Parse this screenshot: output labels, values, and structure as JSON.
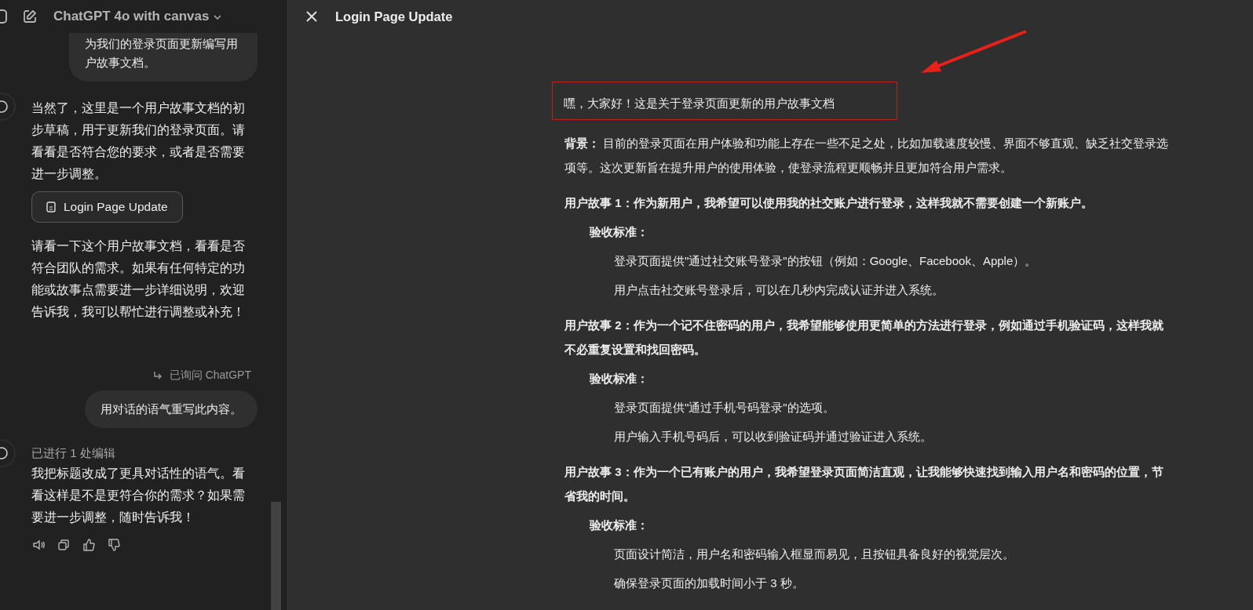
{
  "chat_header": {
    "title": "ChatGPT 4o with canvas"
  },
  "messages": [
    {
      "kind": "user",
      "text": "为我们的登录页面更新编写用户故事文档。"
    },
    {
      "kind": "assistant",
      "paragraphs": [
        "当然了，这里是一个用户故事文档的初步草稿，用于更新我们的登录页面。请看看是否符合您的要求，或者是否需要进一步调整。"
      ],
      "document_button": "Login Page Update",
      "after": "请看一下这个用户故事文档，看看是否符合团队的需求。如果有任何特定的功能或故事点需要进一步详细说明，欢迎告诉我，我可以帮忙进行调整或补充！"
    },
    {
      "kind": "asked",
      "text": "已询问 ChatGPT"
    },
    {
      "kind": "user",
      "text": "用对话的语气重写此内容。"
    },
    {
      "kind": "assistant",
      "status": "已进行 1 处编辑",
      "paragraphs": [
        "我把标题改成了更具对话性的语气。看看这样是不是更符合你的需求？如果需要进一步调整，随时告诉我！"
      ],
      "actions": true
    }
  ],
  "canvas": {
    "title": "Login Page Update",
    "blocks": [
      {
        "kind": "heading",
        "text": "嘿，大家好！这是关于登录页面更新的用户故事文档",
        "highlighted": true
      },
      {
        "kind": "para",
        "text": "**背景：** 目前的登录页面在用户体验和功能上存在一些不足之处，比如加载速度较慢、界面不够直观、缺乏社交登录选项等。这次更新旨在提升用户的使用体验，使登录流程更顺畅并且更加符合用户需求。"
      },
      {
        "kind": "story",
        "text": "用户故事 1：作为新用户，我希望可以使用我的社交账户进行登录，这样我就不需要创建一个新账户。"
      },
      {
        "kind": "criteria",
        "text": "验收标准："
      },
      {
        "kind": "item",
        "text": "登录页面提供\"通过社交账号登录\"的按钮（例如：Google、Facebook、Apple）。"
      },
      {
        "kind": "item",
        "text": "用户点击社交账号登录后，可以在几秒内完成认证并进入系统。"
      },
      {
        "kind": "story",
        "text": "用户故事 2：作为一个记不住密码的用户，我希望能够使用更简单的方法进行登录，例如通过手机验证码，这样我就不必重复设置和找回密码。"
      },
      {
        "kind": "criteria",
        "text": "验收标准："
      },
      {
        "kind": "item",
        "text": "登录页面提供\"通过手机号码登录\"的选项。"
      },
      {
        "kind": "item",
        "text": "用户输入手机号码后，可以收到验证码并通过验证进入系统。"
      },
      {
        "kind": "story",
        "text": "用户故事 3：作为一个已有账户的用户，我希望登录页面简洁直观，让我能够快速找到输入用户名和密码的位置，节省我的时间。"
      },
      {
        "kind": "criteria",
        "text": "验收标准："
      },
      {
        "kind": "item",
        "text": "页面设计简洁，用户名和密码输入框显而易见，且按钮具备良好的视觉层次。"
      },
      {
        "kind": "item",
        "text": "确保登录页面的加载时间小于 3 秒。"
      }
    ]
  }
}
